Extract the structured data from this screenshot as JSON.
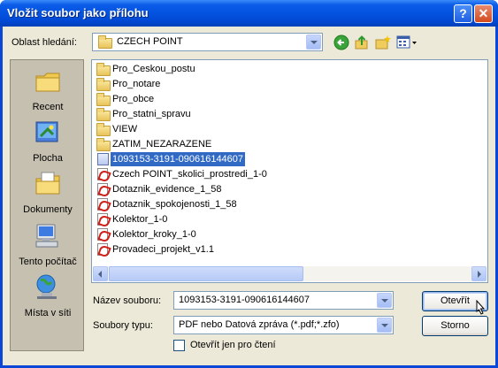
{
  "dialog": {
    "title": "Vložit soubor jako přílohu",
    "help_button": "?",
    "close_button": "✕"
  },
  "location": {
    "label": "Oblast hledání:",
    "value": "CZECH POINT"
  },
  "toolbar": {
    "icons": [
      "back-icon",
      "up-folder-icon",
      "new-folder-icon",
      "view-menu-icon"
    ]
  },
  "places": [
    {
      "label": "Recent",
      "icon": "recent-icon"
    },
    {
      "label": "Plocha",
      "icon": "desktop-icon"
    },
    {
      "label": "Dokumenty",
      "icon": "documents-icon"
    },
    {
      "label": "Tento počítač",
      "icon": "computer-icon"
    },
    {
      "label": "Místa v síti",
      "icon": "network-icon"
    }
  ],
  "files": [
    {
      "name": "Pro_Ceskou_postu",
      "type": "folder"
    },
    {
      "name": "Pro_notare",
      "type": "folder"
    },
    {
      "name": "Pro_obce",
      "type": "folder"
    },
    {
      "name": "Pro_statni_spravu",
      "type": "folder"
    },
    {
      "name": "VIEW",
      "type": "folder"
    },
    {
      "name": "ZATIM_NEZARAZENE",
      "type": "folder"
    },
    {
      "name": "1093153-3191-090616144607",
      "type": "zfo",
      "selected": true
    },
    {
      "name": "Czech POINT_skolici_prostredi_1-0",
      "type": "pdf"
    },
    {
      "name": "Dotaznik_evidence_1_58",
      "type": "pdf"
    },
    {
      "name": "Dotaznik_spokojenosti_1_58",
      "type": "pdf"
    },
    {
      "name": "Kolektor_1-0",
      "type": "pdf"
    },
    {
      "name": "Kolektor_kroky_1-0",
      "type": "pdf"
    },
    {
      "name": "Provadeci_projekt_v1.1",
      "type": "pdf"
    }
  ],
  "filename": {
    "label": "Název souboru:",
    "value": "1093153-3191-090616144607"
  },
  "filetype": {
    "label": "Soubory typu:",
    "value": "PDF nebo  Datová zpráva (*.pdf;*.zfo)"
  },
  "readonly": {
    "label": "Otevřít jen pro čtení",
    "checked": false
  },
  "buttons": {
    "open": "Otevřít",
    "cancel": "Storno"
  }
}
